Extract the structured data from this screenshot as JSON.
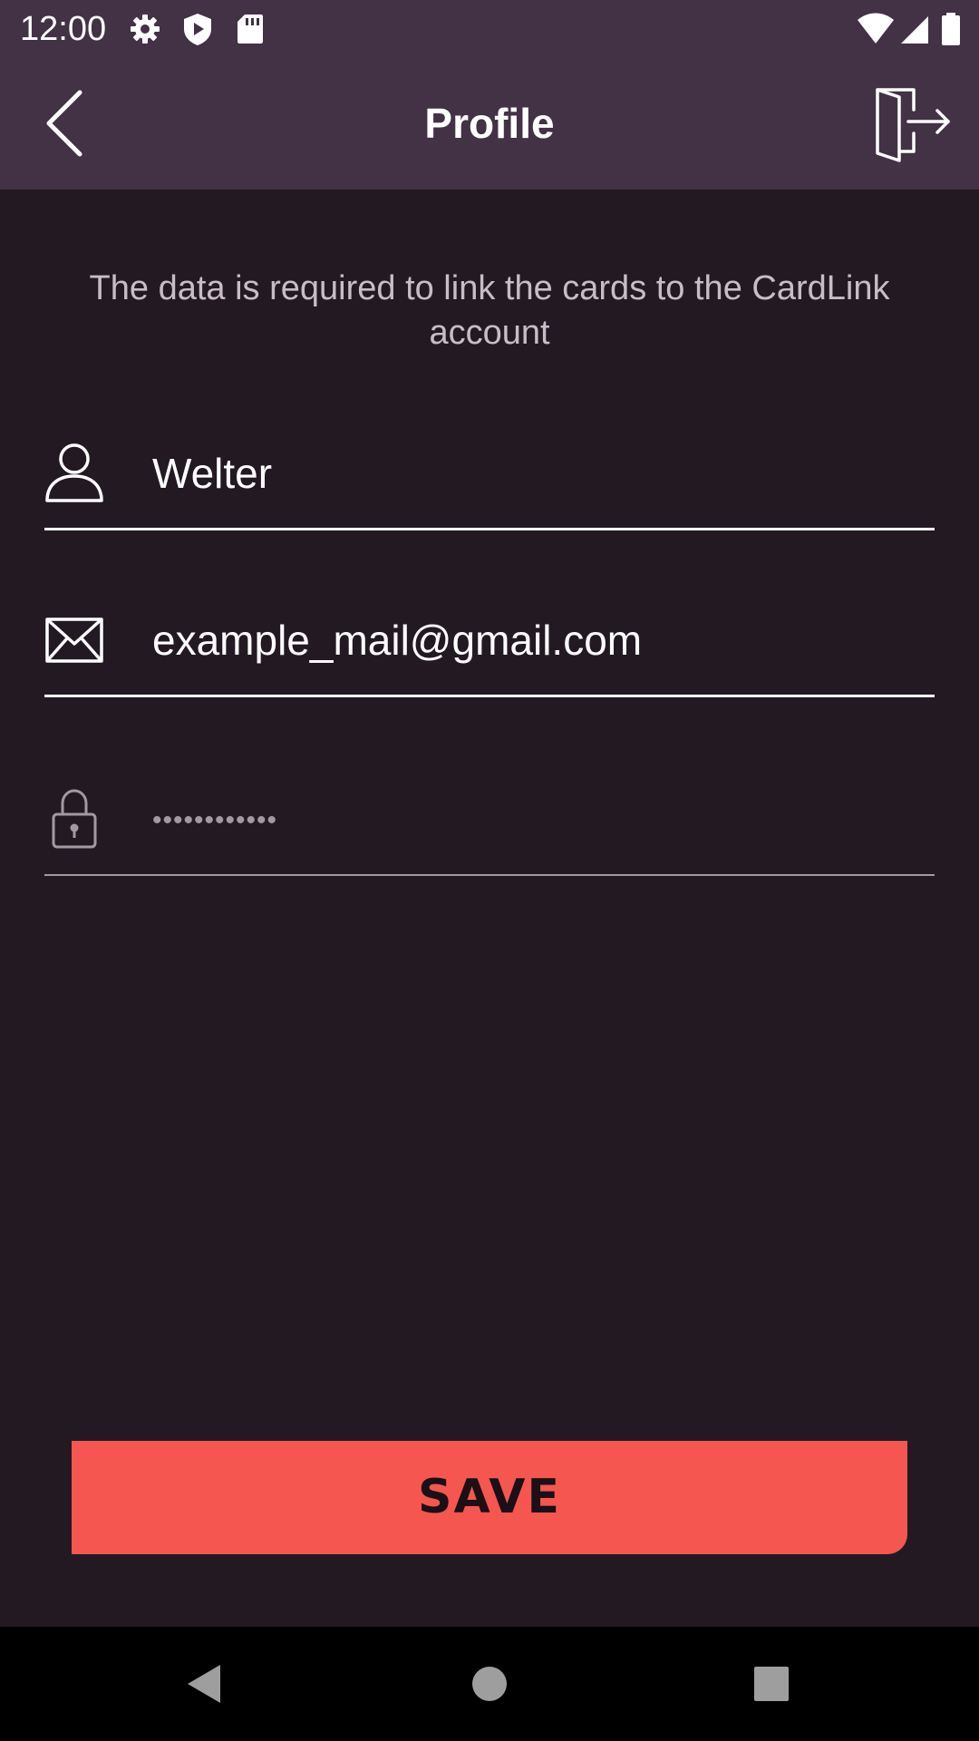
{
  "status_bar": {
    "time": "12:00",
    "left_icons": [
      "settings-icon",
      "shield-play-icon",
      "sd-card-icon"
    ],
    "right_icons": [
      "wifi-icon",
      "cell-signal-icon",
      "battery-icon"
    ]
  },
  "app_bar": {
    "title": "Profile",
    "back_icon": "chevron-left-icon",
    "logout_icon": "logout-door-icon"
  },
  "info_text": "The data is required to link the cards to the CardLink account",
  "form": {
    "name": {
      "value": "Welter",
      "icon": "person-icon"
    },
    "email": {
      "value": "example_mail@gmail.com",
      "icon": "envelope-icon"
    },
    "password": {
      "masked_value": "••••••••••••",
      "icon": "lock-icon"
    }
  },
  "save_label": "SAVE",
  "colors": {
    "background": "#231923",
    "bar": "#433146",
    "accent": "#f55650",
    "muted_text": "#c9bcc6"
  },
  "nav_bar": {
    "icons": [
      "back-triangle-icon",
      "home-circle-icon",
      "recents-square-icon"
    ]
  }
}
